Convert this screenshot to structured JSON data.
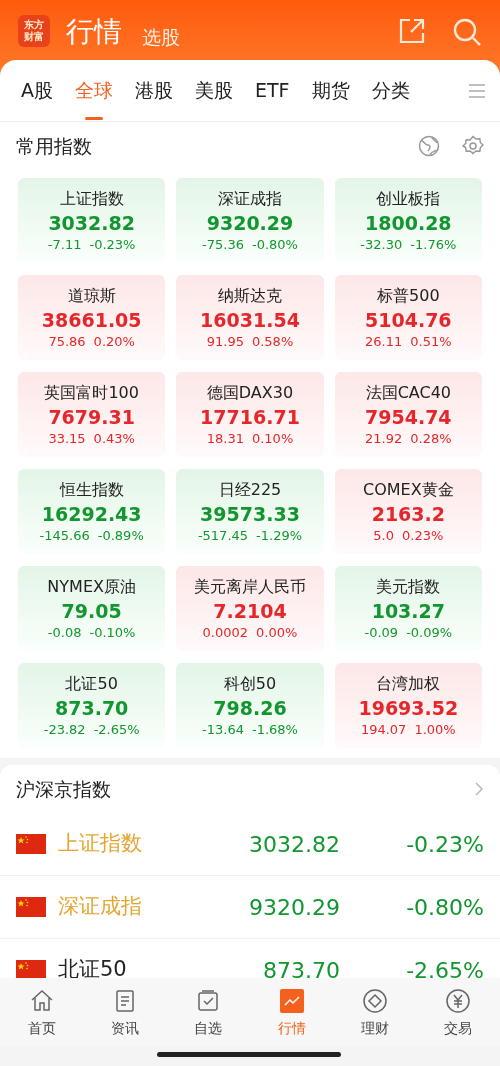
{
  "header": {
    "logo": [
      "东方",
      "财富"
    ],
    "title": "行情",
    "subtitle": "选股"
  },
  "tabs": [
    {
      "label": "A股",
      "selected": false
    },
    {
      "label": "全球",
      "selected": true
    },
    {
      "label": "港股",
      "selected": false
    },
    {
      "label": "美股",
      "selected": false
    },
    {
      "label": "ETF",
      "selected": false
    },
    {
      "label": "期货",
      "selected": false
    },
    {
      "label": "分类",
      "selected": false
    }
  ],
  "common_indices": {
    "title": "常用指数",
    "cards": [
      {
        "name": "上证指数",
        "price": "3032.82",
        "change": "-7.11",
        "percent": "-0.23%",
        "kind": "down"
      },
      {
        "name": "深证成指",
        "price": "9320.29",
        "change": "-75.36",
        "percent": "-0.80%",
        "kind": "down"
      },
      {
        "name": "创业板指",
        "price": "1800.28",
        "change": "-32.30",
        "percent": "-1.76%",
        "kind": "down"
      },
      {
        "name": "道琼斯",
        "price": "38661.05",
        "change": "75.86",
        "percent": "0.20%",
        "kind": "up"
      },
      {
        "name": "纳斯达克",
        "price": "16031.54",
        "change": "91.95",
        "percent": "0.58%",
        "kind": "up"
      },
      {
        "name": "标普500",
        "price": "5104.76",
        "change": "26.11",
        "percent": "0.51%",
        "kind": "up"
      },
      {
        "name": "英国富时100",
        "price": "7679.31",
        "change": "33.15",
        "percent": "0.43%",
        "kind": "up"
      },
      {
        "name": "德国DAX30",
        "price": "17716.71",
        "change": "18.31",
        "percent": "0.10%",
        "kind": "up"
      },
      {
        "name": "法国CAC40",
        "price": "7954.74",
        "change": "21.92",
        "percent": "0.28%",
        "kind": "up"
      },
      {
        "name": "恒生指数",
        "price": "16292.43",
        "change": "-145.66",
        "percent": "-0.89%",
        "kind": "down"
      },
      {
        "name": "日经225",
        "price": "39573.33",
        "change": "-517.45",
        "percent": "-1.29%",
        "kind": "down"
      },
      {
        "name": "COMEX黄金",
        "price": "2163.2",
        "change": "5.0",
        "percent": "0.23%",
        "kind": "up"
      },
      {
        "name": "NYMEX原油",
        "price": "79.05",
        "change": "-0.08",
        "percent": "-0.10%",
        "kind": "down"
      },
      {
        "name": "美元离岸人民币",
        "price": "7.2104",
        "change": "0.0002",
        "percent": "0.00%",
        "kind": "up"
      },
      {
        "name": "美元指数",
        "price": "103.27",
        "change": "-0.09",
        "percent": "-0.09%",
        "kind": "down"
      },
      {
        "name": "北证50",
        "price": "873.70",
        "change": "-23.82",
        "percent": "-2.65%",
        "kind": "down"
      },
      {
        "name": "科创50",
        "price": "798.26",
        "change": "-13.64",
        "percent": "-1.68%",
        "kind": "down"
      },
      {
        "name": "台湾加权",
        "price": "19693.52",
        "change": "194.07",
        "percent": "1.00%",
        "kind": "up"
      }
    ]
  },
  "domestic_indices": {
    "title": "沪深京指数",
    "rows": [
      {
        "name": "上证指数",
        "price": "3032.82",
        "percent": "-0.23%",
        "kind": "down",
        "highlighted": true
      },
      {
        "name": "深证成指",
        "price": "9320.29",
        "percent": "-0.80%",
        "kind": "down",
        "highlighted": true
      },
      {
        "name": "北证50",
        "price": "873.70",
        "percent": "-2.65%",
        "kind": "down",
        "highlighted": false
      }
    ]
  },
  "bottom_nav": [
    {
      "label": "首页",
      "selected": false
    },
    {
      "label": "资讯",
      "selected": false
    },
    {
      "label": "自选",
      "selected": false
    },
    {
      "label": "行情",
      "selected": true
    },
    {
      "label": "理财",
      "selected": false
    },
    {
      "label": "交易",
      "selected": false
    }
  ]
}
